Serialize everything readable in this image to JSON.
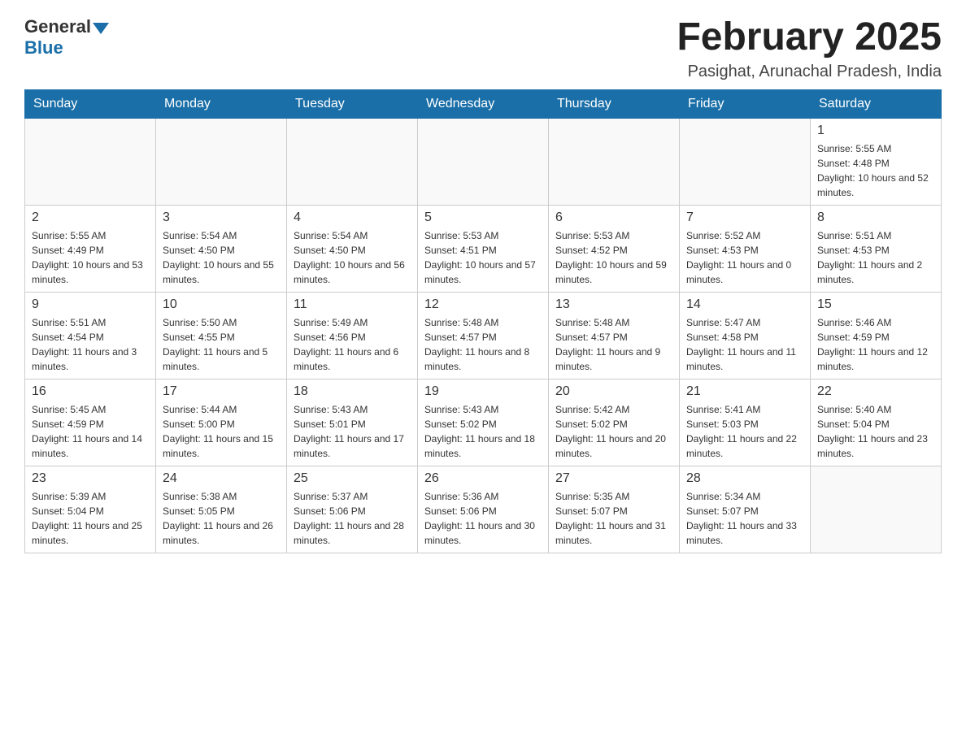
{
  "header": {
    "logo_general": "General",
    "logo_blue": "Blue",
    "title": "February 2025",
    "subtitle": "Pasighat, Arunachal Pradesh, India"
  },
  "weekdays": [
    "Sunday",
    "Monday",
    "Tuesday",
    "Wednesday",
    "Thursday",
    "Friday",
    "Saturday"
  ],
  "weeks": [
    [
      {
        "day": "",
        "sunrise": "",
        "sunset": "",
        "daylight": ""
      },
      {
        "day": "",
        "sunrise": "",
        "sunset": "",
        "daylight": ""
      },
      {
        "day": "",
        "sunrise": "",
        "sunset": "",
        "daylight": ""
      },
      {
        "day": "",
        "sunrise": "",
        "sunset": "",
        "daylight": ""
      },
      {
        "day": "",
        "sunrise": "",
        "sunset": "",
        "daylight": ""
      },
      {
        "day": "",
        "sunrise": "",
        "sunset": "",
        "daylight": ""
      },
      {
        "day": "1",
        "sunrise": "Sunrise: 5:55 AM",
        "sunset": "Sunset: 4:48 PM",
        "daylight": "Daylight: 10 hours and 52 minutes."
      }
    ],
    [
      {
        "day": "2",
        "sunrise": "Sunrise: 5:55 AM",
        "sunset": "Sunset: 4:49 PM",
        "daylight": "Daylight: 10 hours and 53 minutes."
      },
      {
        "day": "3",
        "sunrise": "Sunrise: 5:54 AM",
        "sunset": "Sunset: 4:50 PM",
        "daylight": "Daylight: 10 hours and 55 minutes."
      },
      {
        "day": "4",
        "sunrise": "Sunrise: 5:54 AM",
        "sunset": "Sunset: 4:50 PM",
        "daylight": "Daylight: 10 hours and 56 minutes."
      },
      {
        "day": "5",
        "sunrise": "Sunrise: 5:53 AM",
        "sunset": "Sunset: 4:51 PM",
        "daylight": "Daylight: 10 hours and 57 minutes."
      },
      {
        "day": "6",
        "sunrise": "Sunrise: 5:53 AM",
        "sunset": "Sunset: 4:52 PM",
        "daylight": "Daylight: 10 hours and 59 minutes."
      },
      {
        "day": "7",
        "sunrise": "Sunrise: 5:52 AM",
        "sunset": "Sunset: 4:53 PM",
        "daylight": "Daylight: 11 hours and 0 minutes."
      },
      {
        "day": "8",
        "sunrise": "Sunrise: 5:51 AM",
        "sunset": "Sunset: 4:53 PM",
        "daylight": "Daylight: 11 hours and 2 minutes."
      }
    ],
    [
      {
        "day": "9",
        "sunrise": "Sunrise: 5:51 AM",
        "sunset": "Sunset: 4:54 PM",
        "daylight": "Daylight: 11 hours and 3 minutes."
      },
      {
        "day": "10",
        "sunrise": "Sunrise: 5:50 AM",
        "sunset": "Sunset: 4:55 PM",
        "daylight": "Daylight: 11 hours and 5 minutes."
      },
      {
        "day": "11",
        "sunrise": "Sunrise: 5:49 AM",
        "sunset": "Sunset: 4:56 PM",
        "daylight": "Daylight: 11 hours and 6 minutes."
      },
      {
        "day": "12",
        "sunrise": "Sunrise: 5:48 AM",
        "sunset": "Sunset: 4:57 PM",
        "daylight": "Daylight: 11 hours and 8 minutes."
      },
      {
        "day": "13",
        "sunrise": "Sunrise: 5:48 AM",
        "sunset": "Sunset: 4:57 PM",
        "daylight": "Daylight: 11 hours and 9 minutes."
      },
      {
        "day": "14",
        "sunrise": "Sunrise: 5:47 AM",
        "sunset": "Sunset: 4:58 PM",
        "daylight": "Daylight: 11 hours and 11 minutes."
      },
      {
        "day": "15",
        "sunrise": "Sunrise: 5:46 AM",
        "sunset": "Sunset: 4:59 PM",
        "daylight": "Daylight: 11 hours and 12 minutes."
      }
    ],
    [
      {
        "day": "16",
        "sunrise": "Sunrise: 5:45 AM",
        "sunset": "Sunset: 4:59 PM",
        "daylight": "Daylight: 11 hours and 14 minutes."
      },
      {
        "day": "17",
        "sunrise": "Sunrise: 5:44 AM",
        "sunset": "Sunset: 5:00 PM",
        "daylight": "Daylight: 11 hours and 15 minutes."
      },
      {
        "day": "18",
        "sunrise": "Sunrise: 5:43 AM",
        "sunset": "Sunset: 5:01 PM",
        "daylight": "Daylight: 11 hours and 17 minutes."
      },
      {
        "day": "19",
        "sunrise": "Sunrise: 5:43 AM",
        "sunset": "Sunset: 5:02 PM",
        "daylight": "Daylight: 11 hours and 18 minutes."
      },
      {
        "day": "20",
        "sunrise": "Sunrise: 5:42 AM",
        "sunset": "Sunset: 5:02 PM",
        "daylight": "Daylight: 11 hours and 20 minutes."
      },
      {
        "day": "21",
        "sunrise": "Sunrise: 5:41 AM",
        "sunset": "Sunset: 5:03 PM",
        "daylight": "Daylight: 11 hours and 22 minutes."
      },
      {
        "day": "22",
        "sunrise": "Sunrise: 5:40 AM",
        "sunset": "Sunset: 5:04 PM",
        "daylight": "Daylight: 11 hours and 23 minutes."
      }
    ],
    [
      {
        "day": "23",
        "sunrise": "Sunrise: 5:39 AM",
        "sunset": "Sunset: 5:04 PM",
        "daylight": "Daylight: 11 hours and 25 minutes."
      },
      {
        "day": "24",
        "sunrise": "Sunrise: 5:38 AM",
        "sunset": "Sunset: 5:05 PM",
        "daylight": "Daylight: 11 hours and 26 minutes."
      },
      {
        "day": "25",
        "sunrise": "Sunrise: 5:37 AM",
        "sunset": "Sunset: 5:06 PM",
        "daylight": "Daylight: 11 hours and 28 minutes."
      },
      {
        "day": "26",
        "sunrise": "Sunrise: 5:36 AM",
        "sunset": "Sunset: 5:06 PM",
        "daylight": "Daylight: 11 hours and 30 minutes."
      },
      {
        "day": "27",
        "sunrise": "Sunrise: 5:35 AM",
        "sunset": "Sunset: 5:07 PM",
        "daylight": "Daylight: 11 hours and 31 minutes."
      },
      {
        "day": "28",
        "sunrise": "Sunrise: 5:34 AM",
        "sunset": "Sunset: 5:07 PM",
        "daylight": "Daylight: 11 hours and 33 minutes."
      },
      {
        "day": "",
        "sunrise": "",
        "sunset": "",
        "daylight": ""
      }
    ]
  ]
}
